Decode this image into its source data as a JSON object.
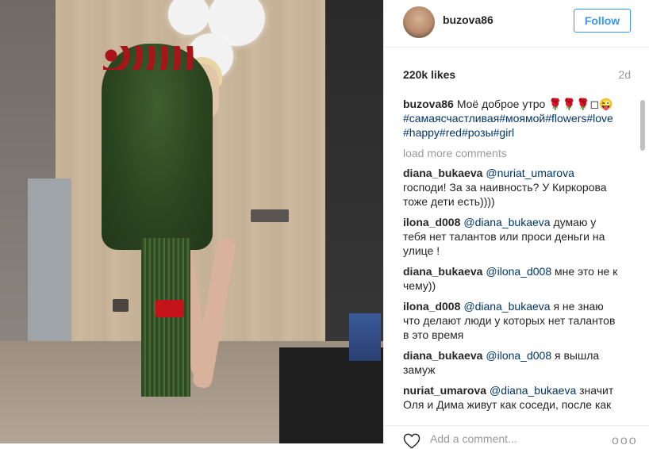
{
  "post": {
    "username": "buzova86",
    "follow_label": "Follow",
    "likes": "220k likes",
    "age": "2d",
    "caption": {
      "user": "buzova86",
      "text": "Моё доброе утро 🌹🌹🌹◻😜",
      "hashtags": "#самаясчастливая#моямой#flowers#love#happy#red#розы#girl"
    },
    "load_more": "load more comments",
    "comments": [
      {
        "user": "diana_bukaeva",
        "mention": "@nuriat_umarova",
        "text": "господи! За за наивность? У Киркорова тоже дети есть))))"
      },
      {
        "user": "ilona_d008",
        "mention": "@diana_bukaeva",
        "text": "думаю у тебя нет талантов или проси деньги на улице !"
      },
      {
        "user": "diana_bukaeva",
        "mention": "@ilona_d008",
        "text": "мне это не к чему))"
      },
      {
        "user": "ilona_d008",
        "mention": "@diana_bukaeva",
        "text": "я не знаю что делают люди у которых нет талантов в это время"
      },
      {
        "user": "diana_bukaeva",
        "mention": "@ilona_d008",
        "text": "я вышла замуж"
      },
      {
        "user": "nuriat_umarova",
        "mention": "@diana_bukaeva",
        "text": "значит Оля и Дима живут как соседи, после как он ушел от своей первой"
      }
    ],
    "add_comment_placeholder": "Add a comment...",
    "more_glyph": "ooo"
  },
  "colors": {
    "link": "#003569",
    "follow": "#3897f0",
    "muted": "#999999"
  },
  "icons": [
    "heart-icon",
    "more-options-icon"
  ]
}
